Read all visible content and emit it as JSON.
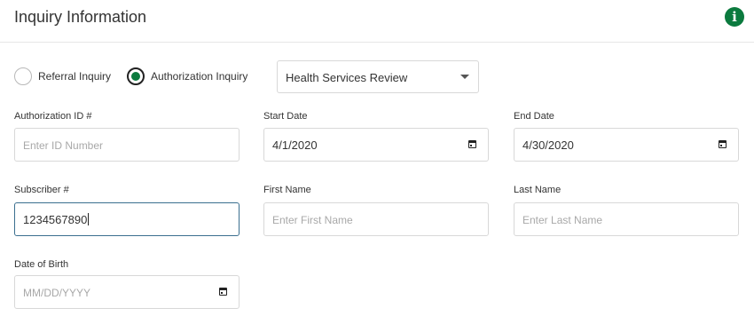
{
  "header": {
    "title": "Inquiry Information",
    "info_icon": "info-icon",
    "info_icon_glyph": "i",
    "accent_color": "#0b7a3e"
  },
  "inquiry_type": {
    "options": [
      {
        "label": "Referral Inquiry",
        "selected": false
      },
      {
        "label": "Authorization Inquiry",
        "selected": true
      }
    ],
    "review_select": {
      "value": "Health Services Review"
    }
  },
  "fields": {
    "authorization_id": {
      "label": "Authorization ID #",
      "value": "",
      "placeholder": "Enter ID Number"
    },
    "start_date": {
      "label": "Start Date",
      "value": "4/1/2020",
      "icon": "calendar-icon"
    },
    "end_date": {
      "label": "End Date",
      "value": "4/30/2020",
      "icon": "calendar-icon"
    },
    "subscriber": {
      "label": "Subscriber #",
      "value": "1234567890",
      "focused": true
    },
    "first_name": {
      "label": "First Name",
      "value": "",
      "placeholder": "Enter First Name"
    },
    "last_name": {
      "label": "Last Name",
      "value": "",
      "placeholder": "Enter Last Name"
    },
    "date_of_birth": {
      "label": "Date of Birth",
      "value": "",
      "placeholder": "MM/DD/YYYY",
      "icon": "calendar-icon"
    }
  }
}
